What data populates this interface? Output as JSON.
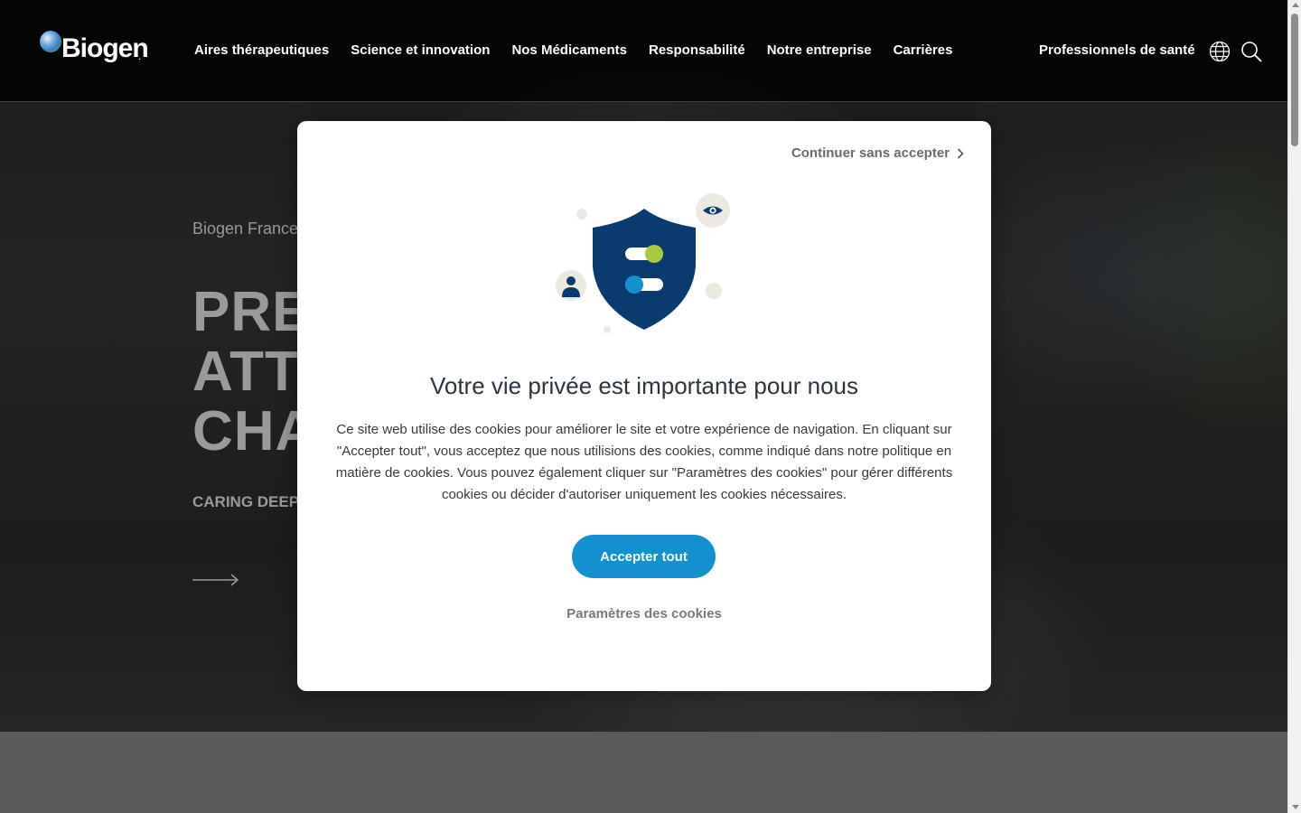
{
  "header": {
    "logo_text": "Biogen",
    "logo_suffix": ".",
    "menu": [
      {
        "label": "Aires thérapeutiques"
      },
      {
        "label": "Science et innovation"
      },
      {
        "label": "Nos Médicaments"
      },
      {
        "label": "Responsabilité"
      },
      {
        "label": "Notre entreprise"
      },
      {
        "label": "Carrières"
      }
    ],
    "professionals_label": "Professionnels de santé",
    "icons": [
      "globe-icon",
      "search-icon"
    ]
  },
  "hero": {
    "eyebrow": "Biogen France",
    "title_lines": [
      "PREN",
      "ATTE",
      "CHAN"
    ],
    "subtitle": "CARING DEEPL",
    "arrow_icon": "arrow-right-icon"
  },
  "modal": {
    "continue_label": "Continuer sans accepter",
    "title": "Votre vie privée est importante pour nous",
    "body": "Ce site web utilise des cookies pour améliorer le site et votre expérience de navigation. En cliquant sur \"Accepter tout\", vous acceptez que nous utilisions des cookies, comme indiqué dans notre politique en matière de cookies. Vous pouvez également cliquer sur \"Paramètres des cookies\" pour gérer différents cookies ou décider d'autoriser uniquement les cookies nécessaires.",
    "accept_label": "Accepter tout",
    "settings_label": "Paramètres des cookies",
    "illustration_icons": [
      "privacy-shield-icon",
      "eye-icon",
      "user-icon"
    ]
  },
  "colors": {
    "accent": "#1391cf",
    "shield": "#0b3a6e",
    "toggle_green": "#a8c93a",
    "toggle_blue": "#1391cf"
  }
}
